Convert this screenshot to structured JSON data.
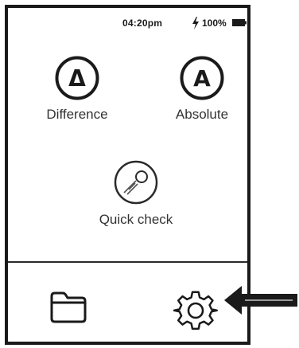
{
  "status_bar": {
    "time": "04:20pm",
    "battery_percent": "100%",
    "charging_icon": "lightning-icon",
    "battery_icon": "battery-full-icon"
  },
  "modes": [
    {
      "symbol": "Δ",
      "label": "Difference",
      "icon": "delta-icon"
    },
    {
      "symbol": "A",
      "label": "Absolute",
      "icon": "letter-a-icon"
    },
    {
      "label": "Quick check",
      "icon": "quick-check-icon"
    }
  ],
  "bottom_bar": {
    "folder_icon": "folder-icon",
    "settings_icon": "gear-icon"
  },
  "annotation": {
    "arrow_icon": "left-arrow-icon"
  },
  "colors": {
    "ink": "#1a1a1a",
    "label": "#333333",
    "background": "#ffffff"
  }
}
